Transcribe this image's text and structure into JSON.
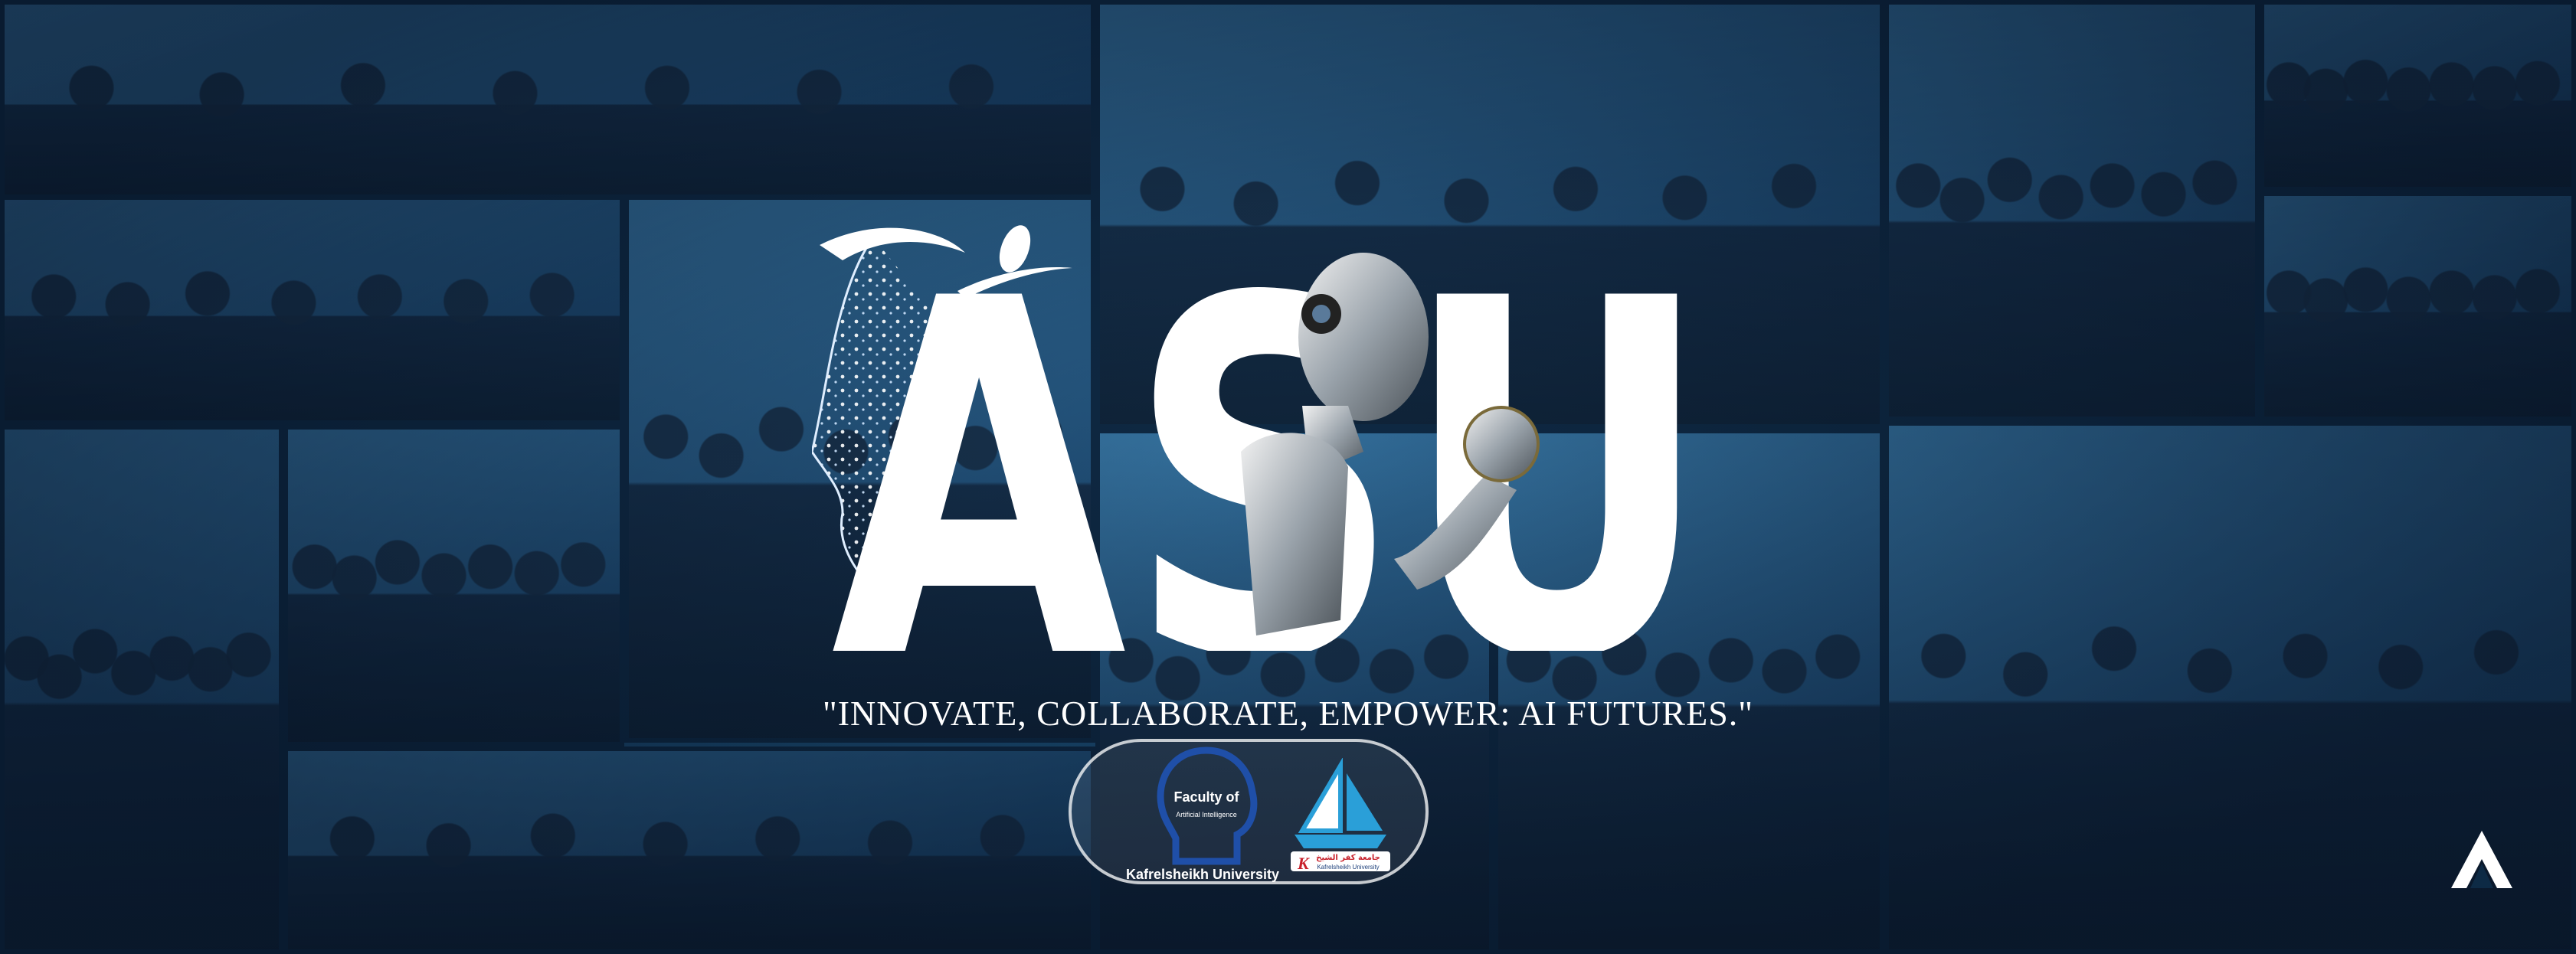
{
  "banner": {
    "title": "ASU",
    "tagline": "\"INNOVATE, COLLABORATE, EMPOWER: AI FUTURES.\""
  },
  "logos": {
    "faculty": {
      "line1": "Faculty of",
      "line2": "Artificial Intelligence",
      "caption": "Kafrelsheikh University"
    },
    "university": {
      "arabic_name": "جامعة كفر الشيخ",
      "english_name": "Kafrelsheikh University"
    }
  },
  "colors": {
    "overlay": "#1a4a70",
    "title": "#ffffff",
    "faculty_logo": "#1f4fa8",
    "university_logo_sail": "#2a9fd8",
    "university_logo_red": "#c8202a"
  },
  "icons": [
    "robot-figure-icon",
    "wireframe-face-icon",
    "corner-brand-icon"
  ]
}
